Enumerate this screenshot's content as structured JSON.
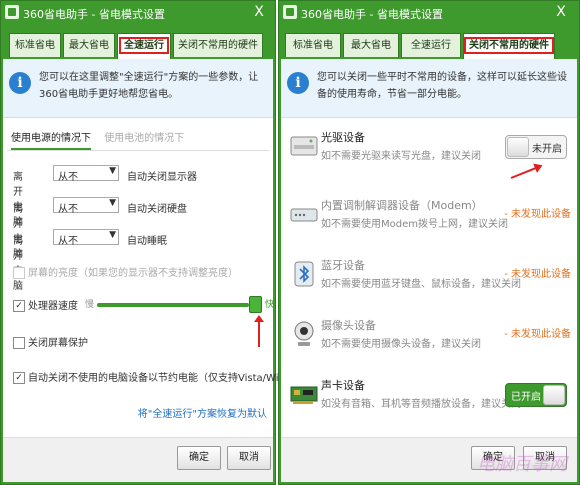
{
  "left_window": {
    "title": "360省电助手 - 省电模式设置",
    "close": "X",
    "tabs": [
      "标准省电",
      "最大省电",
      "全速运行",
      "关闭不常用的硬件"
    ],
    "active_tab": 2,
    "info": "您可以在这里调整\"全速运行\"方案的一些参数，让360省电助手更好地帮您省电。",
    "subtabs": [
      "使用电源的情况下",
      "使用电池的情况下"
    ],
    "settings": [
      {
        "label": "离开电脑",
        "value": "从不",
        "suffix": "自动关闭显示器"
      },
      {
        "label": "离开电脑",
        "value": "从不",
        "suffix": "自动关闭硬盘"
      },
      {
        "label": "离开电脑",
        "value": "从不",
        "suffix": "自动睡眠"
      }
    ],
    "brightness_label": "屏幕的亮度（如果您的显示器不支持调整亮度）",
    "cpu_label": "处理器速度",
    "cpu_checked_mark": "✓",
    "slider_slow": "慢",
    "slider_fast": "快",
    "slider_value": 1.0,
    "screensaver_label": "关闭屏幕保护",
    "auto_close_label": "自动关闭不使用的电脑设备以节约电能（仅支持Vista/Win7）",
    "auto_close_checked_mark": "✓",
    "restore_link": "将\"全速运行\"方案恢复为默认",
    "ok_button": "确定",
    "cancel_button": "取消"
  },
  "right_window": {
    "title": "360省电助手 - 省电模式设置",
    "close": "X",
    "tabs": [
      "标准省电",
      "最大省电",
      "全速运行",
      "关闭不常用的硬件"
    ],
    "active_tab": 3,
    "info": "您可以关闭一些平时不常用的设备，这样可以延长这些设备的使用寿命，节省一部分电能。",
    "devices": [
      {
        "name": "光驱设备",
        "desc": "如不需要光驱来读写光盘，建议关闭",
        "status": "未开启",
        "state": "off"
      },
      {
        "name": "内置调制解调器设备（Modem）",
        "desc": "如不需要使用Modem拨号上网，建议关闭",
        "status": "- 未发现此设备",
        "state": "none"
      },
      {
        "name": "蓝牙设备",
        "desc": "如不需要使用蓝牙键盘、鼠标设备，建议关闭",
        "status": "- 未发现此设备",
        "state": "none"
      },
      {
        "name": "摄像头设备",
        "desc": "如不需要使用摄像头设备，建议关闭",
        "status": "- 未发现此设备",
        "state": "none"
      },
      {
        "name": "声卡设备",
        "desc": "如没有音箱、耳机等音频播放设备，建议关闭",
        "status": "已开启",
        "state": "on"
      }
    ],
    "ok_button": "确定",
    "cancel_button": "取消",
    "watermark": "电脑百事网"
  }
}
